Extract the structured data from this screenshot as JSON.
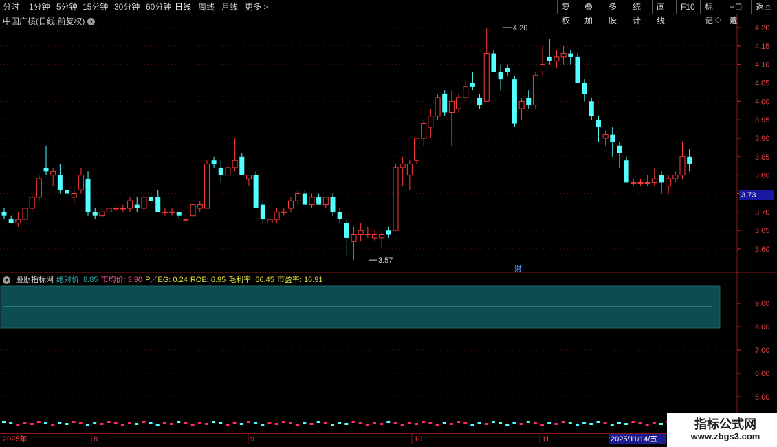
{
  "toolbar": {
    "left_items": [
      "分时",
      "1分钟",
      "5分钟",
      "15分钟",
      "30分钟",
      "60分钟",
      "日线",
      "周线",
      "月线",
      "更多 >"
    ],
    "active": "日线",
    "right_items": [
      "复权",
      "叠加",
      "多股",
      "统计",
      "画线",
      "F10",
      "标记",
      "+自选",
      "返回"
    ]
  },
  "chart": {
    "title": "中国广核(日线,前复权)",
    "high_label": "4.20",
    "low_label": "3.57",
    "current_price": "3.73",
    "cai_marker": "财"
  },
  "indicator": {
    "name": "股朋指标网",
    "fields": [
      {
        "label": "绝对价:",
        "value": "8.85",
        "color": "#2fa8a8"
      },
      {
        "label": "市均价:",
        "value": "3.90",
        "color": "#ff5a8a"
      },
      {
        "label": "P／EG:",
        "value": "0.24",
        "color": "#e0e040"
      },
      {
        "label": "ROE:",
        "value": "6.95",
        "color": "#e0e040"
      },
      {
        "label": "毛利率:",
        "value": "66.45",
        "color": "#e0e040"
      },
      {
        "label": "市盈率:",
        "value": "16.91",
        "color": "#e0e040"
      }
    ]
  },
  "price_axis": [
    "4.20",
    "4.15",
    "4.10",
    "4.05",
    "4.00",
    "3.95",
    "3.90",
    "3.85",
    "3.80",
    "3.75",
    "3.70",
    "3.65",
    "3.60"
  ],
  "indicator_axis": [
    "9.00",
    "8.00",
    "7.00",
    "6.00",
    "5.00"
  ],
  "date_axis": {
    "labels": [
      "2025年",
      "8",
      "9",
      "10",
      "11"
    ],
    "highlight": "2025/11/14/五"
  },
  "watermark": {
    "title": "指标公式网",
    "url": "www.zbgs3.com"
  },
  "chart_data": {
    "type": "candlestick",
    "series": [
      {
        "o": 3.7,
        "h": 3.71,
        "l": 3.68,
        "c": 3.69
      },
      {
        "o": 3.68,
        "h": 3.69,
        "l": 3.67,
        "c": 3.67
      },
      {
        "o": 3.67,
        "h": 3.7,
        "l": 3.66,
        "c": 3.68
      },
      {
        "o": 3.68,
        "h": 3.72,
        "l": 3.67,
        "c": 3.71
      },
      {
        "o": 3.71,
        "h": 3.75,
        "l": 3.7,
        "c": 3.74
      },
      {
        "o": 3.74,
        "h": 3.8,
        "l": 3.73,
        "c": 3.79
      },
      {
        "o": 3.82,
        "h": 3.88,
        "l": 3.8,
        "c": 3.81
      },
      {
        "o": 3.8,
        "h": 3.82,
        "l": 3.77,
        "c": 3.81
      },
      {
        "o": 3.8,
        "h": 3.83,
        "l": 3.75,
        "c": 3.76
      },
      {
        "o": 3.76,
        "h": 3.77,
        "l": 3.74,
        "c": 3.75
      },
      {
        "o": 3.74,
        "h": 3.76,
        "l": 3.72,
        "c": 3.75
      },
      {
        "o": 3.76,
        "h": 3.82,
        "l": 3.75,
        "c": 3.8
      },
      {
        "o": 3.79,
        "h": 3.81,
        "l": 3.69,
        "c": 3.7
      },
      {
        "o": 3.7,
        "h": 3.71,
        "l": 3.68,
        "c": 3.69
      },
      {
        "o": 3.69,
        "h": 3.71,
        "l": 3.68,
        "c": 3.7
      },
      {
        "o": 3.7,
        "h": 3.72,
        "l": 3.69,
        "c": 3.71
      },
      {
        "o": 3.71,
        "h": 3.72,
        "l": 3.7,
        "c": 3.71
      },
      {
        "o": 3.71,
        "h": 3.72,
        "l": 3.7,
        "c": 3.71
      },
      {
        "o": 3.71,
        "h": 3.74,
        "l": 3.7,
        "c": 3.73
      },
      {
        "o": 3.72,
        "h": 3.74,
        "l": 3.7,
        "c": 3.71
      },
      {
        "o": 3.71,
        "h": 3.75,
        "l": 3.7,
        "c": 3.74
      },
      {
        "o": 3.74,
        "h": 3.75,
        "l": 3.72,
        "c": 3.73
      },
      {
        "o": 3.74,
        "h": 3.76,
        "l": 3.7,
        "c": 3.7
      },
      {
        "o": 3.7,
        "h": 3.71,
        "l": 3.69,
        "c": 3.7
      },
      {
        "o": 3.7,
        "h": 3.71,
        "l": 3.69,
        "c": 3.7
      },
      {
        "o": 3.7,
        "h": 3.7,
        "l": 3.68,
        "c": 3.69
      },
      {
        "o": 3.68,
        "h": 3.7,
        "l": 3.67,
        "c": 3.68
      },
      {
        "o": 3.69,
        "h": 3.73,
        "l": 3.69,
        "c": 3.72
      },
      {
        "o": 3.71,
        "h": 3.73,
        "l": 3.7,
        "c": 3.72
      },
      {
        "o": 3.71,
        "h": 3.84,
        "l": 3.71,
        "c": 3.83
      },
      {
        "o": 3.84,
        "h": 3.85,
        "l": 3.82,
        "c": 3.83
      },
      {
        "o": 3.82,
        "h": 3.84,
        "l": 3.78,
        "c": 3.8
      },
      {
        "o": 3.8,
        "h": 3.84,
        "l": 3.79,
        "c": 3.82
      },
      {
        "o": 3.82,
        "h": 3.9,
        "l": 3.81,
        "c": 3.84
      },
      {
        "o": 3.85,
        "h": 3.86,
        "l": 3.8,
        "c": 3.8
      },
      {
        "o": 3.79,
        "h": 3.8,
        "l": 3.77,
        "c": 3.8
      },
      {
        "o": 3.8,
        "h": 3.81,
        "l": 3.71,
        "c": 3.71
      },
      {
        "o": 3.72,
        "h": 3.73,
        "l": 3.67,
        "c": 3.68
      },
      {
        "o": 3.67,
        "h": 3.69,
        "l": 3.65,
        "c": 3.68
      },
      {
        "o": 3.68,
        "h": 3.71,
        "l": 3.67,
        "c": 3.7
      },
      {
        "o": 3.7,
        "h": 3.71,
        "l": 3.69,
        "c": 3.7
      },
      {
        "o": 3.71,
        "h": 3.74,
        "l": 3.7,
        "c": 3.73
      },
      {
        "o": 3.73,
        "h": 3.76,
        "l": 3.72,
        "c": 3.75
      },
      {
        "o": 3.75,
        "h": 3.76,
        "l": 3.72,
        "c": 3.72
      },
      {
        "o": 3.72,
        "h": 3.75,
        "l": 3.71,
        "c": 3.74
      },
      {
        "o": 3.74,
        "h": 3.75,
        "l": 3.72,
        "c": 3.72
      },
      {
        "o": 3.72,
        "h": 3.74,
        "l": 3.71,
        "c": 3.74
      },
      {
        "o": 3.74,
        "h": 3.75,
        "l": 3.69,
        "c": 3.7
      },
      {
        "o": 3.7,
        "h": 3.71,
        "l": 3.67,
        "c": 3.68
      },
      {
        "o": 3.67,
        "h": 3.68,
        "l": 3.58,
        "c": 3.63
      },
      {
        "o": 3.62,
        "h": 3.66,
        "l": 3.57,
        "c": 3.64
      },
      {
        "o": 3.64,
        "h": 3.67,
        "l": 3.62,
        "c": 3.65
      },
      {
        "o": 3.64,
        "h": 3.66,
        "l": 3.63,
        "c": 3.64
      },
      {
        "o": 3.63,
        "h": 3.65,
        "l": 3.62,
        "c": 3.64
      },
      {
        "o": 3.63,
        "h": 3.65,
        "l": 3.6,
        "c": 3.64
      },
      {
        "o": 3.65,
        "h": 3.66,
        "l": 3.63,
        "c": 3.64
      },
      {
        "o": 3.65,
        "h": 3.83,
        "l": 3.65,
        "c": 3.82
      },
      {
        "o": 3.82,
        "h": 3.85,
        "l": 3.77,
        "c": 3.83
      },
      {
        "o": 3.8,
        "h": 3.84,
        "l": 3.76,
        "c": 3.83
      },
      {
        "o": 3.84,
        "h": 3.9,
        "l": 3.83,
        "c": 3.9
      },
      {
        "o": 3.9,
        "h": 3.95,
        "l": 3.88,
        "c": 3.94
      },
      {
        "o": 3.93,
        "h": 3.98,
        "l": 3.9,
        "c": 3.96
      },
      {
        "o": 3.96,
        "h": 4.02,
        "l": 3.95,
        "c": 4.01
      },
      {
        "o": 4.02,
        "h": 4.03,
        "l": 3.96,
        "c": 3.97
      },
      {
        "o": 3.97,
        "h": 4.03,
        "l": 3.88,
        "c": 4.0
      },
      {
        "o": 3.98,
        "h": 4.02,
        "l": 3.97,
        "c": 4.01
      },
      {
        "o": 4.01,
        "h": 4.06,
        "l": 4.0,
        "c": 4.04
      },
      {
        "o": 4.05,
        "h": 4.08,
        "l": 4.03,
        "c": 4.04
      },
      {
        "o": 4.01,
        "h": 4.02,
        "l": 3.98,
        "c": 3.99
      },
      {
        "o": 4.0,
        "h": 4.2,
        "l": 4.0,
        "c": 4.13
      },
      {
        "o": 4.13,
        "h": 4.14,
        "l": 4.08,
        "c": 4.08
      },
      {
        "o": 4.08,
        "h": 4.1,
        "l": 4.03,
        "c": 4.06
      },
      {
        "o": 4.09,
        "h": 4.1,
        "l": 4.07,
        "c": 4.08
      },
      {
        "o": 4.06,
        "h": 4.07,
        "l": 3.93,
        "c": 3.94
      },
      {
        "o": 3.98,
        "h": 4.01,
        "l": 3.95,
        "c": 4.0
      },
      {
        "o": 4.01,
        "h": 4.03,
        "l": 3.98,
        "c": 3.99
      },
      {
        "o": 3.99,
        "h": 4.08,
        "l": 3.98,
        "c": 4.07
      },
      {
        "o": 4.08,
        "h": 4.15,
        "l": 4.07,
        "c": 4.1
      },
      {
        "o": 4.12,
        "h": 4.17,
        "l": 4.1,
        "c": 4.11
      },
      {
        "o": 4.11,
        "h": 4.14,
        "l": 4.09,
        "c": 4.12
      },
      {
        "o": 4.12,
        "h": 4.15,
        "l": 4.1,
        "c": 4.13
      },
      {
        "o": 4.13,
        "h": 4.14,
        "l": 4.1,
        "c": 4.12
      },
      {
        "o": 4.12,
        "h": 4.13,
        "l": 4.05,
        "c": 4.05
      },
      {
        "o": 4.05,
        "h": 4.06,
        "l": 4.0,
        "c": 4.02
      },
      {
        "o": 4.0,
        "h": 4.01,
        "l": 3.95,
        "c": 3.96
      },
      {
        "o": 3.95,
        "h": 3.96,
        "l": 3.89,
        "c": 3.93
      },
      {
        "o": 3.9,
        "h": 3.92,
        "l": 3.88,
        "c": 3.91
      },
      {
        "o": 3.91,
        "h": 3.93,
        "l": 3.85,
        "c": 3.89
      },
      {
        "o": 3.88,
        "h": 3.89,
        "l": 3.82,
        "c": 3.86
      },
      {
        "o": 3.84,
        "h": 3.85,
        "l": 3.78,
        "c": 3.78
      },
      {
        "o": 3.78,
        "h": 3.79,
        "l": 3.77,
        "c": 3.78
      },
      {
        "o": 3.78,
        "h": 3.79,
        "l": 3.77,
        "c": 3.78
      },
      {
        "o": 3.78,
        "h": 3.8,
        "l": 3.77,
        "c": 3.78
      },
      {
        "o": 3.78,
        "h": 3.82,
        "l": 3.77,
        "c": 3.79
      },
      {
        "o": 3.8,
        "h": 3.81,
        "l": 3.75,
        "c": 3.78
      },
      {
        "o": 3.77,
        "h": 3.8,
        "l": 3.75,
        "c": 3.79
      },
      {
        "o": 3.79,
        "h": 3.81,
        "l": 3.78,
        "c": 3.8
      },
      {
        "o": 3.8,
        "h": 3.89,
        "l": 3.79,
        "c": 3.85
      },
      {
        "o": 3.85,
        "h": 3.87,
        "l": 3.81,
        "c": 3.83
      }
    ],
    "high": 4.2,
    "low": 3.57,
    "ylim": [
      3.57,
      4.23
    ]
  }
}
